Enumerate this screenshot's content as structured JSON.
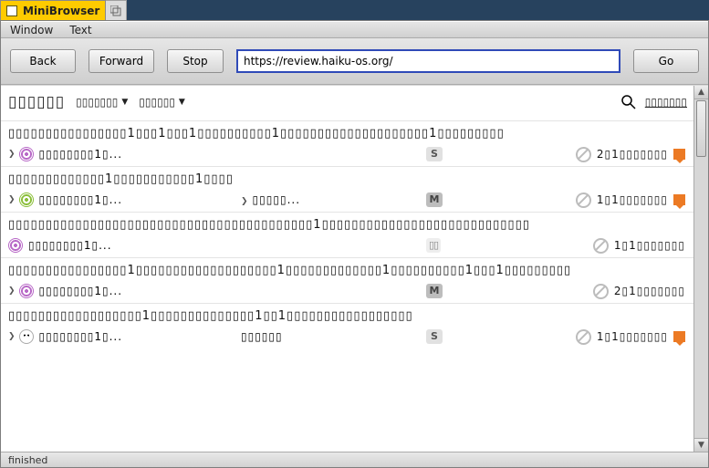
{
  "window": {
    "title": "MiniBrowser"
  },
  "menus": {
    "window": "Window",
    "text": "Text"
  },
  "toolbar": {
    "back": "Back",
    "forward": "Forward",
    "stop": "Stop",
    "go": "Go"
  },
  "url": "https://review.haiku-os.org/",
  "status": "finished",
  "page": {
    "brand": "▯▯▯▯▯▯",
    "dd1": "▯▯▯▯▯▯▯",
    "dd2": "▯▯▯▯▯▯",
    "signin": "▯▯▯▯▯▯▯"
  },
  "rows": [
    {
      "title": "▯▯▯▯▯▯▯▯▯▯▯▯▯▯▯▯1▯▯▯1▯▯▯1▯▯▯▯▯▯▯▯▯▯1▯▯▯▯▯▯▯▯▯▯▯▯▯▯▯▯▯▯▯▯1▯▯▯▯▯▯▯▯▯",
      "avatar": "pink",
      "owner": "▯▯▯▯▯▯▯▯1▯...",
      "mid": "",
      "badge": "S",
      "badgeCls": "s",
      "rt": "2▯1▯▯▯▯▯▯▯",
      "comment": true,
      "chev": true
    },
    {
      "title": "▯▯▯▯▯▯▯▯▯▯▯▯▯1▯▯▯▯▯▯▯▯▯▯▯1▯▯▯▯",
      "avatar": "green",
      "owner": "▯▯▯▯▯▯▯▯1▯...",
      "mid": "▯▯▯▯▯...",
      "badge": "M",
      "badgeCls": "m",
      "rt": "1▯1▯▯▯▯▯▯▯",
      "comment": true,
      "chev": true,
      "midchev": true
    },
    {
      "title": "▯▯▯▯▯▯▯▯▯▯▯▯▯▯▯▯▯▯▯▯▯▯▯▯▯▯▯▯▯▯▯▯▯▯▯▯▯▯▯▯▯1▯▯▯▯▯▯▯▯▯▯▯▯▯▯▯▯▯▯▯▯▯▯▯▯▯▯▯▯",
      "avatar": "pink",
      "owner": "▯▯▯▯▯▯▯▯1▯...",
      "mid": "",
      "badge": "▯▯",
      "badgeCls": "d",
      "rt": "1▯1▯▯▯▯▯▯▯",
      "comment": false,
      "chev": false
    },
    {
      "title": "▯▯▯▯▯▯▯▯▯▯▯▯▯▯▯▯1▯▯▯▯▯▯▯▯▯▯▯▯▯▯▯▯▯▯▯1▯▯▯▯▯▯▯▯▯▯▯▯▯1▯▯▯▯▯▯▯▯▯▯1▯▯▯1▯▯▯▯▯▯▯▯▯",
      "avatar": "pink",
      "owner": "▯▯▯▯▯▯▯▯1▯...",
      "mid": "",
      "badge": "M",
      "badgeCls": "m",
      "rt": "2▯1▯▯▯▯▯▯▯",
      "comment": false,
      "chev": true
    },
    {
      "title": "▯▯▯▯▯▯▯▯▯▯▯▯▯▯▯▯▯▯1▯▯▯▯▯▯▯▯▯▯▯▯▯▯1▯▯1▯▯▯▯▯▯▯▯▯▯▯▯▯▯▯▯▯",
      "avatar": "face",
      "owner": "▯▯▯▯▯▯▯▯1▯...",
      "mid": "▯▯▯▯▯▯",
      "badge": "S",
      "badgeCls": "s",
      "rt": "1▯1▯▯▯▯▯▯▯",
      "comment": true,
      "chev": true
    }
  ]
}
